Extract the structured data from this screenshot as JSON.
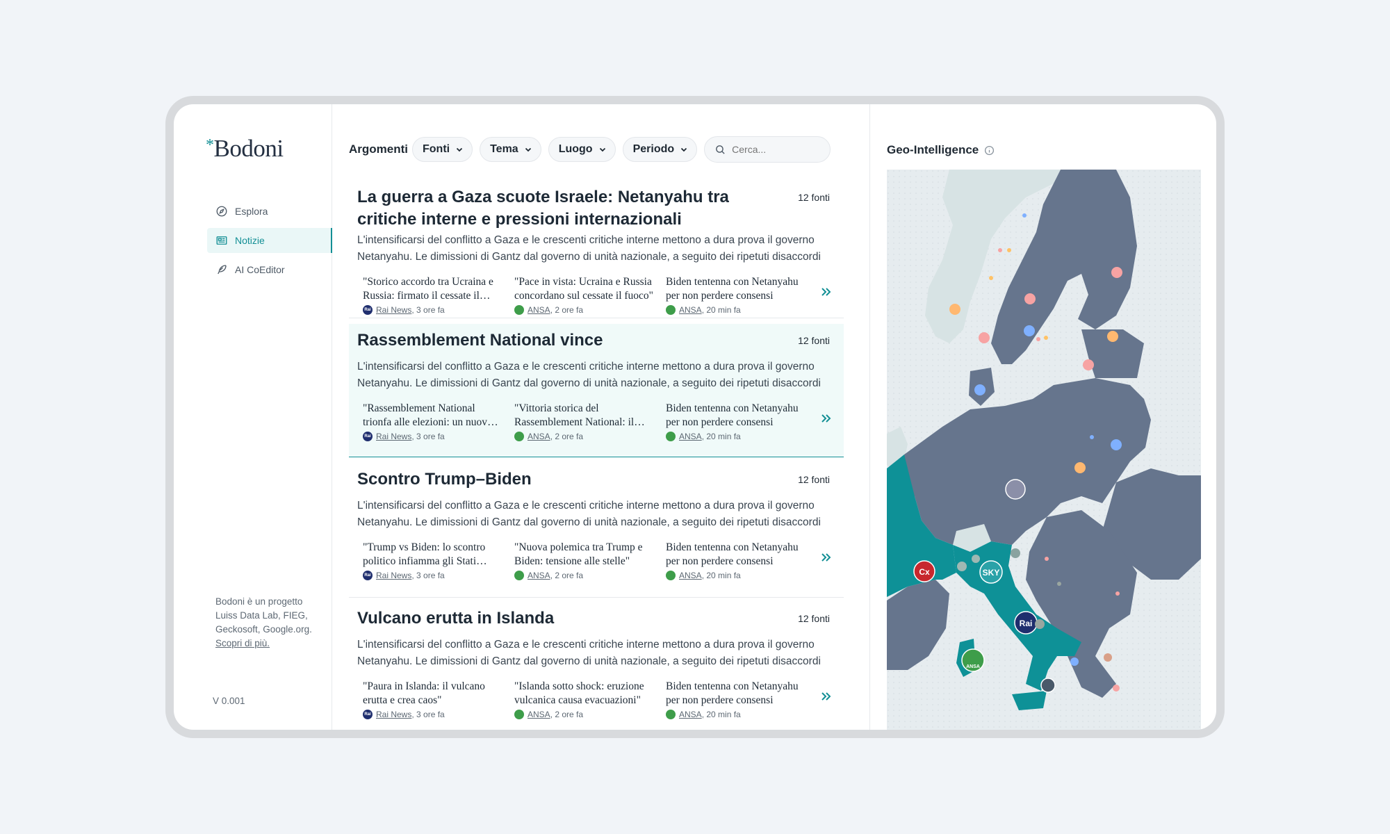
{
  "app": {
    "logo_mark": "*",
    "logo_text": "Bodoni"
  },
  "nav": [
    {
      "label": "Esplora",
      "icon": "compass-icon",
      "active": false
    },
    {
      "label": "Notizie",
      "icon": "newspaper-icon",
      "active": true
    },
    {
      "label": "AI CoEditor",
      "icon": "feather-icon",
      "active": false
    }
  ],
  "about": {
    "text": "Bodoni è un progetto Luiss Data Lab, FIEG, Geckosoft, Google.org.",
    "link": "Scopri di più."
  },
  "version": "V 0.001",
  "filters": {
    "label": "Argomenti",
    "chips": [
      "Fonti",
      "Tema",
      "Luogo",
      "Periodo"
    ],
    "search_placeholder": "Cerca..."
  },
  "stories": [
    {
      "title": "La guerra a Gaza scuote Israele: Netanyahu tra critiche interne e pressioni internazionali",
      "count": "12 fonti",
      "summary": "L'intensificarsi del conflitto a Gaza e le crescenti critiche interne mettono a dura prova il governo Netanyahu. Le dimissioni di Gantz dal governo di unità nazionale, a seguito dei ripetuti disaccordi sulla gestione della guerra.",
      "headlines": [
        {
          "text": "\"Storico accordo tra Ucraina e Russia: firmato il cessate il fuoco\"",
          "source": "Rai News",
          "time": ", 3 ore fa",
          "logo": "rai"
        },
        {
          "text": "\"Pace in vista: Ucraina e Russia concordano sul cessate il fuoco\"",
          "source": "ANSA",
          "time": ", 2 ore fa",
          "logo": "ansa"
        },
        {
          "text": "Biden tentenna con Netanyahu per non perdere consensi",
          "source": "ANSA",
          "time": ", 20 min fa",
          "logo": "ansa"
        }
      ]
    },
    {
      "title": "Rassemblement National vince",
      "count": "12 fonti",
      "summary": "L'intensificarsi del conflitto a Gaza e le crescenti critiche interne mettono a dura prova il governo Netanyahu. Le dimissioni di Gantz dal governo di unità nazionale, a seguito dei ripetuti disaccordi sulla gestione della guerra.",
      "headlines": [
        {
          "text": "\"Rassemblement National trionfa alle elezioni: un nuovo corso\"",
          "source": "Rai News",
          "time": ", 3 ore fa",
          "logo": "rai"
        },
        {
          "text": "\"Vittoria storica del Rassemblement National: il paese cambia\"",
          "source": "ANSA",
          "time": ", 2 ore fa",
          "logo": "ansa"
        },
        {
          "text": "Biden tentenna con Netanyahu per non perdere consensi",
          "source": "ANSA",
          "time": ", 20 min fa",
          "logo": "ansa"
        }
      ]
    },
    {
      "title": "Scontro Trump–Biden",
      "count": "12 fonti",
      "summary": "L'intensificarsi del conflitto a Gaza e le crescenti critiche interne mettono a dura prova il governo Netanyahu. Le dimissioni di Gantz dal governo di unità nazionale, a seguito dei ripetuti disaccordi sulla gestione della guerra.",
      "headlines": [
        {
          "text": "\"Trump vs Biden: lo scontro politico infiamma gli Stati Uniti\"",
          "source": "Rai News",
          "time": ", 3 ore fa",
          "logo": "rai"
        },
        {
          "text": "\"Nuova polemica tra Trump e Biden: tensione alle stelle\"",
          "source": "ANSA",
          "time": ", 2 ore fa",
          "logo": "ansa"
        },
        {
          "text": "Biden tentenna con Netanyahu per non perdere consensi",
          "source": "ANSA",
          "time": ", 20 min fa",
          "logo": "ansa"
        }
      ]
    },
    {
      "title": "Vulcano erutta in Islanda",
      "count": "12 fonti",
      "summary": "L'intensificarsi del conflitto a Gaza e le crescenti critiche interne mettono a dura prova il governo Netanyahu. Le dimissioni di Gantz dal governo di unità nazionale, a seguito dei ripetuti disaccordi sulla gestione della guerra.",
      "headlines": [
        {
          "text": "\"Paura in Islanda: il vulcano erutta e crea caos\"",
          "source": "Rai News",
          "time": ", 3 ore fa",
          "logo": "rai"
        },
        {
          "text": "\"Islanda sotto shock: eruzione vulcanica causa evacuazioni\"",
          "source": "ANSA",
          "time": ", 2 ore fa",
          "logo": "ansa"
        },
        {
          "text": "Biden tentenna con Netanyahu per non perdere consensi",
          "source": "ANSA",
          "time": ", 20 min fa",
          "logo": "ansa"
        }
      ]
    }
  ],
  "geo": {
    "title": "Geo-Intelligence",
    "map_labels": {
      "rai": "Rai",
      "ansa": "ANSA",
      "sky": "SKY"
    },
    "colors": {
      "land": "#66758d",
      "highlight": "#0e9197",
      "sea": "#e6ecef",
      "non_eu": "#d7e3e4"
    }
  }
}
